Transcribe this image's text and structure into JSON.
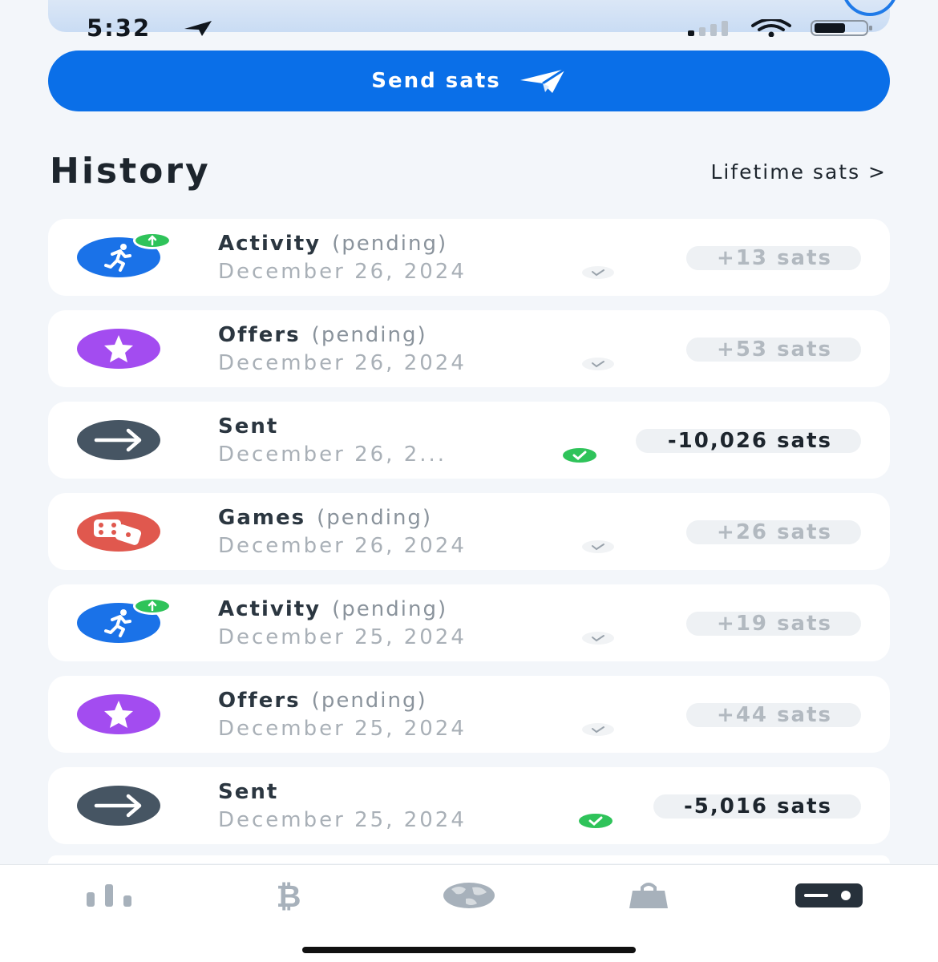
{
  "status": {
    "time": "5:32"
  },
  "send_button": {
    "label": "Send sats"
  },
  "history": {
    "title": "History",
    "lifetime_link": "Lifetime sats >",
    "rows": [
      {
        "type": "activity",
        "icon": "running-person-icon",
        "name": "Activity",
        "status": "(pending)",
        "date": "December 26, 2024",
        "amount": "+13 sats"
      },
      {
        "type": "offers",
        "icon": "star-icon",
        "name": "Offers",
        "status": "(pending)",
        "date": "December 26, 2024",
        "amount": "+53 sats"
      },
      {
        "type": "sent",
        "icon": "arrow-right-icon",
        "name": "Sent",
        "status": "",
        "date": "December 26, 2...",
        "amount": "-10,026 sats"
      },
      {
        "type": "games",
        "icon": "dice-icon",
        "name": "Games",
        "status": "(pending)",
        "date": "December 26, 2024",
        "amount": "+26 sats"
      },
      {
        "type": "activity",
        "icon": "running-person-icon",
        "name": "Activity",
        "status": "(pending)",
        "date": "December 25, 2024",
        "amount": "+19 sats"
      },
      {
        "type": "offers",
        "icon": "star-icon",
        "name": "Offers",
        "status": "(pending)",
        "date": "December 25, 2024",
        "amount": "+44 sats"
      },
      {
        "type": "sent",
        "icon": "arrow-right-icon",
        "name": "Sent",
        "status": "",
        "date": "December 25, 2024",
        "amount": "-5,016 sats"
      }
    ]
  },
  "tabs": [
    {
      "icon": "bar-chart-icon",
      "active": false
    },
    {
      "icon": "bitcoin-icon",
      "active": false
    },
    {
      "icon": "globe-icon",
      "active": false
    },
    {
      "icon": "shopping-bag-icon",
      "active": false
    },
    {
      "icon": "wallet-card-icon",
      "active": true
    }
  ],
  "colors": {
    "primary": "#0a6fe8",
    "activity": "#1a72e8",
    "offers": "#a34cf0",
    "sent": "#465563",
    "games": "#e0584e",
    "success": "#2fc35a"
  }
}
